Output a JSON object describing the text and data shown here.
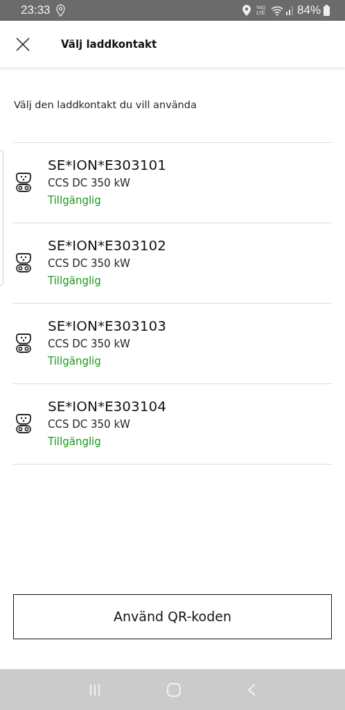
{
  "status_bar": {
    "time": "23:33",
    "volte_top": "Vo))",
    "volte_bottom": "LTE",
    "battery": "84%"
  },
  "header": {
    "title": "Välj laddkontakt"
  },
  "instruction": "Välj den laddkontakt du vill använda",
  "connectors": [
    {
      "id": "SE*ION*E303101",
      "type": "CCS DC 350 kW",
      "status": "Tillgänglig",
      "available": true
    },
    {
      "id": "SE*ION*E303102",
      "type": "CCS DC 350 kW",
      "status": "Tillgänglig",
      "available": true
    },
    {
      "id": "SE*ION*E303103",
      "type": "CCS DC 350 kW",
      "status": "Tillgänglig",
      "available": true
    },
    {
      "id": "SE*ION*E303104",
      "type": "CCS DC 350 kW",
      "status": "Tillgänglig",
      "available": true
    }
  ],
  "qr_button": "Använd QR-koden"
}
